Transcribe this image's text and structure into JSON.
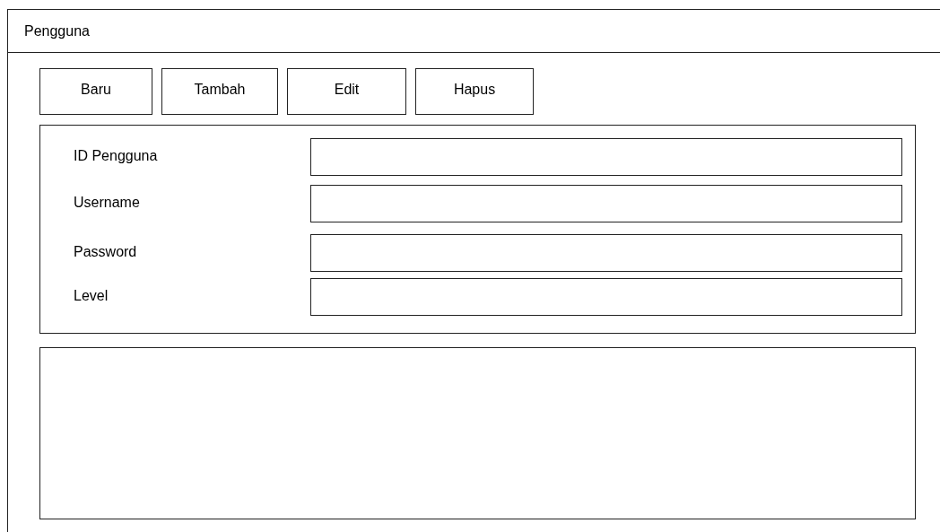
{
  "window": {
    "title": "Pengguna"
  },
  "buttons": [
    "Baru",
    "Tambah",
    "Edit",
    "Hapus"
  ],
  "form": {
    "fields": [
      {
        "label": "ID Pengguna"
      },
      {
        "label": "Username"
      },
      {
        "label": "Password"
      },
      {
        "label": "Level"
      }
    ]
  }
}
